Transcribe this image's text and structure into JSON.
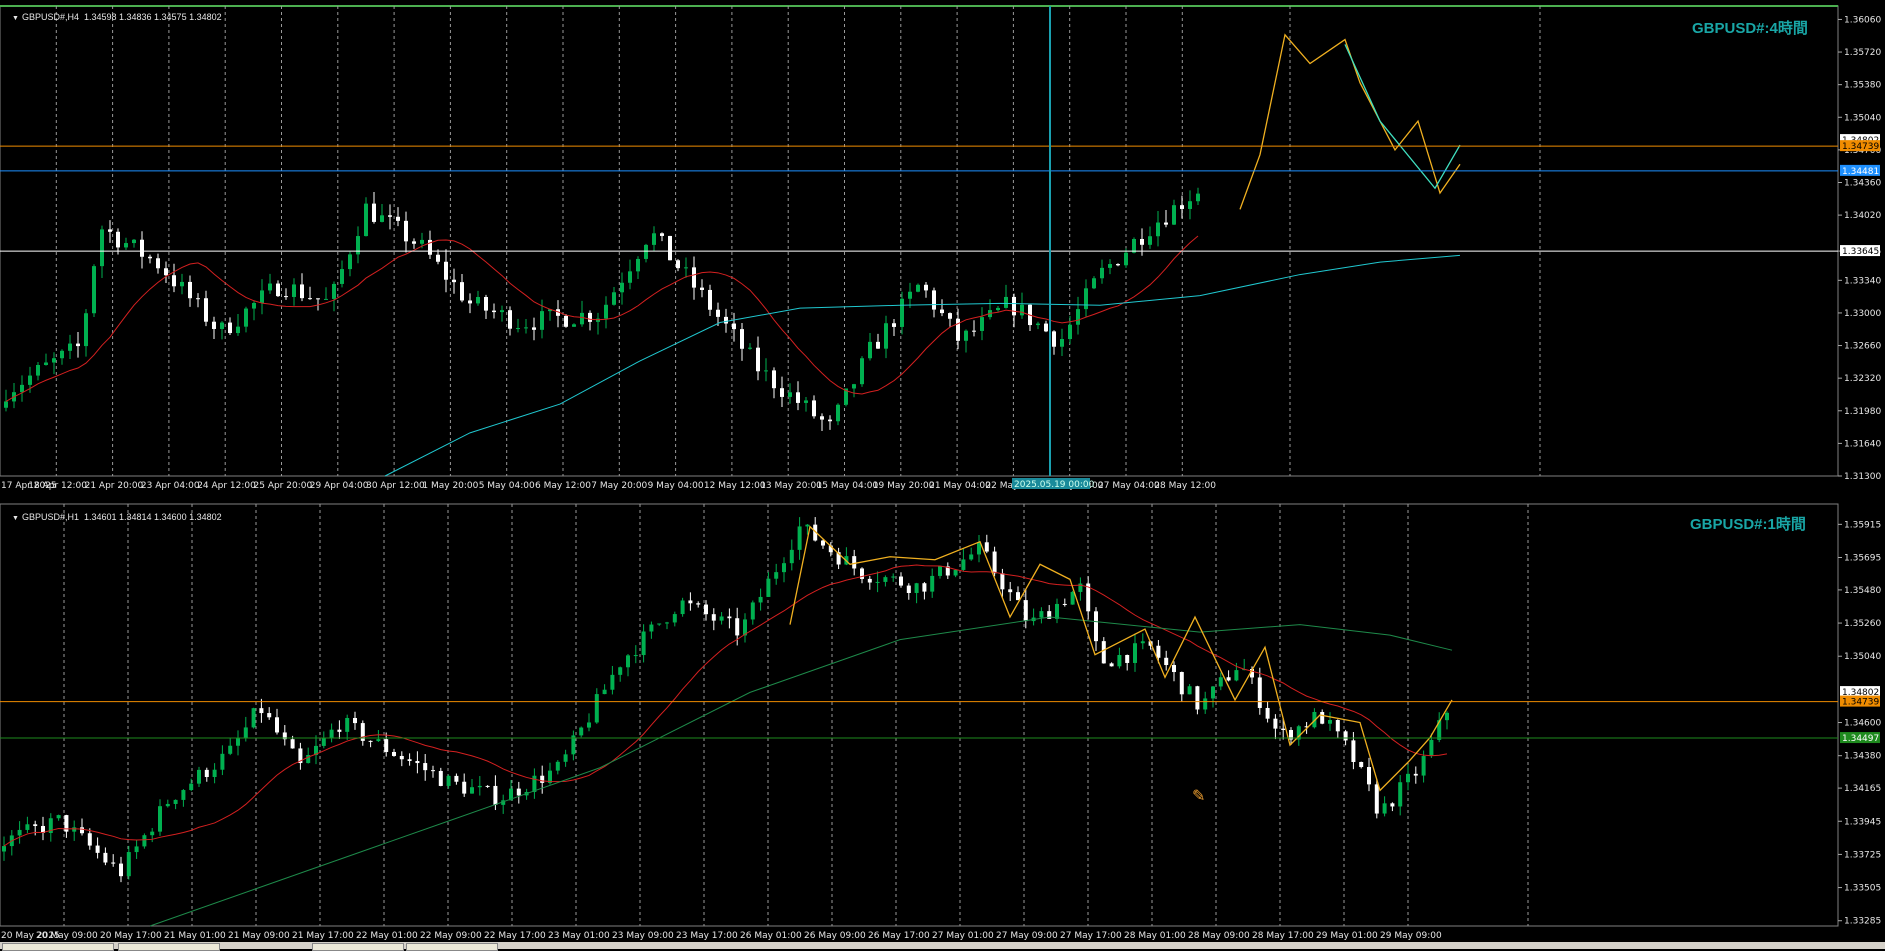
{
  "colors": {
    "bull": "#00b050",
    "bear": "#ffffff",
    "ma_fast": "#d42020",
    "ma_slow_h4": "#20c8d0",
    "ma_slow_h1": "#1e8a4a",
    "zigzag": "#f0b020",
    "orange_line": "#f08c00",
    "blue_line": "#1e90ff",
    "white_line": "#ffffff",
    "green_line": "#1e8a1e",
    "crosshair": "#1aa0b0",
    "label": "#19a6a6"
  },
  "h4": {
    "header": "GBPUSD#,H4  1.34598 1.34836 1.34575 1.34802",
    "label": "GBPUSD#:4時間",
    "price_levels": [
      "1.36060",
      "1.35720",
      "1.35380",
      "1.35040",
      "1.34700",
      "1.34360",
      "1.34020",
      "1.33645",
      "1.33340",
      "1.33000",
      "1.32660",
      "1.32320",
      "1.31980",
      "1.31640",
      "1.31300"
    ],
    "price_tags": {
      "orange": "1.34739",
      "blue": "1.34481",
      "white": "1.33645",
      "hidden": "1.34802"
    },
    "time_labels": [
      "17 Apr 2025",
      "18 Apr 12:00",
      "21 Apr 20:00",
      "23 Apr 04:00",
      "24 Apr 12:00",
      "25 Apr 20:00",
      "29 Apr 04:00",
      "30 Apr 12:00",
      "1 May 20:00",
      "5 May 04:00",
      "6 May 12:00",
      "7 May 20:00",
      "9 May 04:00",
      "12 May 12:00",
      "13 May 20:00",
      "15 May 04:00",
      "19 May 20:00",
      "21 May 04:00",
      "22 May 12:00",
      "23 May 20:00",
      "27 May 04:00",
      "28 May 12:00"
    ],
    "crosshair_time": "2025.05.19 00:00"
  },
  "h1": {
    "header": "GBPUSD#,H1  1.34601 1.34814 1.34600 1.34802",
    "label": "GBPUSD#:1時間",
    "price_levels": [
      "1.35915",
      "1.35695",
      "1.35480",
      "1.35260",
      "1.35040",
      "1.34600",
      "1.34380",
      "1.34165",
      "1.33945",
      "1.33725",
      "1.33505",
      "1.33285"
    ],
    "price_tags": {
      "white": "1.34802",
      "orange": "1.34739",
      "green": "1.34497"
    },
    "time_labels": [
      "20 May 2025",
      "20 May 09:00",
      "20 May 17:00",
      "21 May 01:00",
      "21 May 09:00",
      "21 May 17:00",
      "22 May 01:00",
      "22 May 09:00",
      "22 May 17:00",
      "23 May 01:00",
      "23 May 09:00",
      "23 May 17:00",
      "26 May 01:00",
      "26 May 09:00",
      "26 May 17:00",
      "27 May 01:00",
      "27 May 09:00",
      "27 May 17:00",
      "28 May 01:00",
      "28 May 09:00",
      "28 May 17:00",
      "29 May 01:00",
      "29 May 09:00"
    ]
  }
}
